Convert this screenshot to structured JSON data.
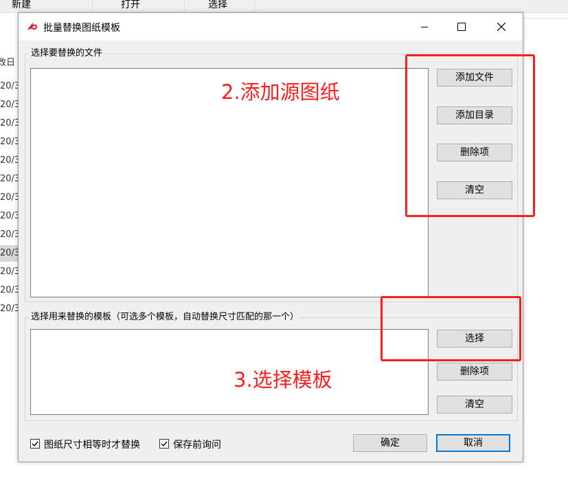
{
  "background_app": {
    "toolbar": [
      "新建",
      "打开",
      "选择"
    ],
    "column_fragment": "改日",
    "row_fragments": [
      "20/3",
      "20/3",
      "20/3",
      "20/3",
      "20/3",
      "20/3",
      "20/3",
      "20/3",
      "20/3",
      "20/3",
      "20/3",
      "20/3",
      "20/3"
    ]
  },
  "dialog": {
    "title": "批量替换图纸模板",
    "accent_color": "#e02020",
    "window_controls": [
      "minimize",
      "maximize",
      "close"
    ],
    "files_group": {
      "label": "选择要替换的文件",
      "buttons": [
        "添加文件",
        "添加目录",
        "删除项",
        "清空"
      ]
    },
    "template_group": {
      "label": "选择用来替换的模板（可选多个模板，自动替换尺寸匹配的那一个）",
      "buttons": [
        "选择",
        "删除项",
        "清空"
      ]
    },
    "options": [
      {
        "label": "图纸尺寸相等时才替换",
        "checked": true
      },
      {
        "label": "保存前询问",
        "checked": true
      }
    ],
    "ok_label": "确定",
    "cancel_label": "取消"
  },
  "annotations": {
    "color": "#ff1d1d",
    "step2": "2.添加源图纸",
    "step3": "3.选择模板"
  }
}
